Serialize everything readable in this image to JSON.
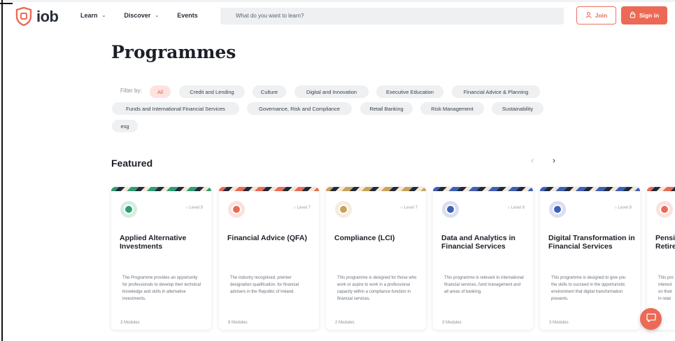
{
  "header": {
    "logo_text": "iob",
    "nav": [
      {
        "label": "Learn",
        "has_dropdown": true
      },
      {
        "label": "Discover",
        "has_dropdown": true
      },
      {
        "label": "Events",
        "has_dropdown": false
      }
    ],
    "search_placeholder": "What do you want to learn?",
    "join_label": "Join",
    "signin_label": "Sign in"
  },
  "page_title": "Programmes",
  "filters": {
    "label": "Filter by:",
    "chips": [
      {
        "label": "All",
        "active": true
      },
      {
        "label": "Credit and Lending",
        "active": false
      },
      {
        "label": "Culture",
        "active": false
      },
      {
        "label": "Digital and Innovation",
        "active": false
      },
      {
        "label": "Executive Education",
        "active": false
      },
      {
        "label": "Financial Advice & Planning",
        "active": false
      },
      {
        "label": "Funds and International Financial Services",
        "active": false
      },
      {
        "label": "Governance, Risk and Compliance",
        "active": false
      },
      {
        "label": "Retail Banking",
        "active": false
      },
      {
        "label": "Risk Management",
        "active": false
      },
      {
        "label": "Sustainability",
        "active": false
      },
      {
        "label": "esg",
        "active": false
      }
    ]
  },
  "featured": {
    "heading": "Featured",
    "prev_icon": "chevron-left-icon",
    "next_icon": "chevron-right-icon",
    "cards": [
      {
        "title": "Applied Alternative Investments",
        "level": "Level 9",
        "description": "The Programme provides an opportunity for professionals to develop their technical knowledge and skills in alternative investments.",
        "modules": "3 Modules",
        "accent": "#2e9e6e",
        "band": [
          "#2e9e6e",
          "#1f2a3a"
        ]
      },
      {
        "title": "Financial Advice (QFA)",
        "level": "Level 7",
        "description": "The industry recognised, premier designation qualification, for financial advisers in the Republic of Ireland.",
        "modules": "8 Modules",
        "accent": "#ec6a55",
        "band": [
          "#ec6a55",
          "#1f2a3a"
        ]
      },
      {
        "title": "Compliance (LCI)",
        "level": "Level 7",
        "description": "This programme is designed for those who work or aspire to work in a professional capacity within a compliance function in financial services.",
        "modules": "2 Modules",
        "accent": "#c9a25a",
        "band": [
          "#c9a25a",
          "#1f2a3a"
        ]
      },
      {
        "title": "Data and Analytics in Financial Services",
        "level": "Level 9",
        "description": "This programme is relevant to international financial services, fund management and all areas of banking.",
        "modules": "3 Modules",
        "accent": "#3f5fb8",
        "band": [
          "#3f5fb8",
          "#1f2a3a"
        ]
      },
      {
        "title": "Digital Transformation in Financial Services",
        "level": "Level 9",
        "description": "This programme is designed to give you the skills to succeed in the opportunistic environment that digital transformation presents.",
        "modules": "3 Modules",
        "accent": "#3f5fb8",
        "band": [
          "#3f5fb8",
          "#1f2a3a"
        ]
      },
      {
        "title": "Pensi Retire",
        "level": "",
        "description": "This pro interest on their in relat",
        "modules": "",
        "accent": "#ec6a55",
        "band": [
          "#ec6a55",
          "#1f2a3a"
        ]
      }
    ]
  },
  "chat_icon": "chat-icon",
  "colors": {
    "brand": "#ec6a55",
    "chip_bg": "#eef0f1",
    "chip_active_bg": "#fde3dd"
  }
}
